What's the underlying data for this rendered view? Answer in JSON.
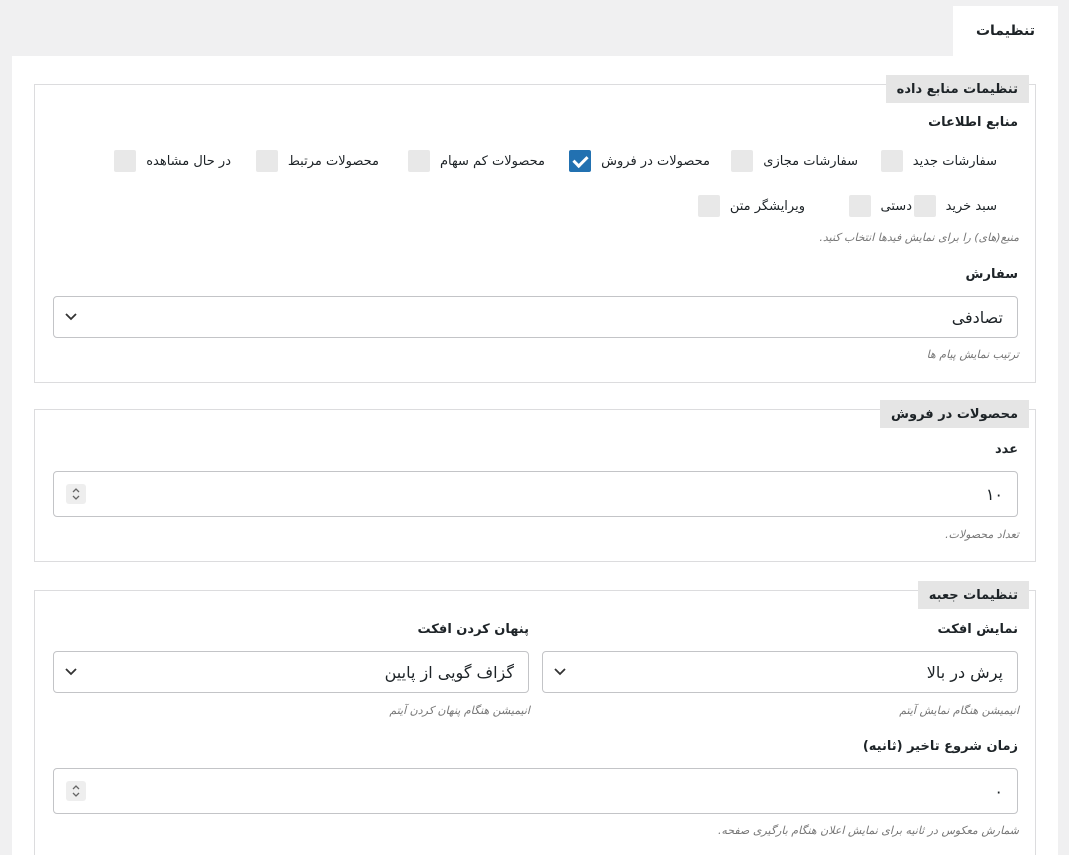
{
  "tab": {
    "label": "تنظیمات"
  },
  "datasource": {
    "legend": "تنظیمات منابع داده",
    "sources_label": "منابع اطلاعات",
    "checkboxes": [
      {
        "label": "سفارشات جدید",
        "checked": false
      },
      {
        "label": "سفارشات مجازی",
        "checked": false
      },
      {
        "label": "محصولات در فروش",
        "checked": true
      },
      {
        "label": "محصولات کم سهام",
        "checked": false
      },
      {
        "label": "محصولات مرتبط",
        "checked": false
      },
      {
        "label": "در حال مشاهده",
        "checked": false
      },
      {
        "label": "سبد خرید",
        "checked": false
      },
      {
        "label": "دستی",
        "checked": false
      },
      {
        "label": "ویرایشگر متن",
        "checked": false
      }
    ],
    "sources_desc": "منبع(های) را برای نمایش فیدها انتخاب کنید.",
    "order_label": "سفارش",
    "order_value": "تصادفی",
    "order_desc": "ترتیب نمایش پیام ها"
  },
  "onsale": {
    "legend": "محصولات در فروش",
    "count_label": "عدد",
    "count_value": "۱۰",
    "count_desc": "تعداد محصولات."
  },
  "box": {
    "legend": "تنظیمات جعبه",
    "show_effect_label": "نمایش افکت",
    "show_effect_value": "پرش در بالا",
    "show_effect_desc": "انیمیشن هنگام نمایش آیتم",
    "hide_effect_label": "پنهان کردن افکت",
    "hide_effect_value": "گزاف گویی از پایین",
    "hide_effect_desc": "انیمیشن هنگام پنهان کردن آیتم",
    "delay_label": "زمان شروع تاخیر (ثانیه)",
    "delay_value": "۰",
    "delay_desc": "شمارش معکوس در ثانیه برای نمایش اعلان هنگام بارگیری صفحه."
  }
}
